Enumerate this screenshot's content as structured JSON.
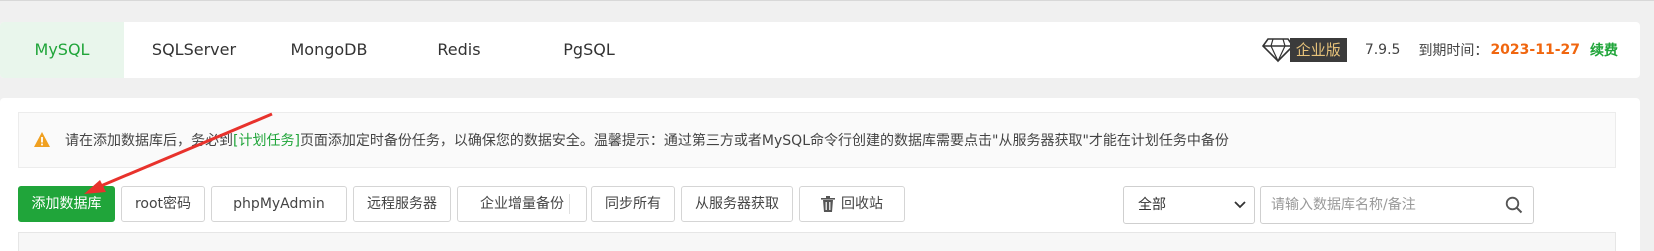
{
  "tabs": [
    {
      "label": "MySQL"
    },
    {
      "label": "SQLServer"
    },
    {
      "label": "MongoDB"
    },
    {
      "label": "Redis"
    },
    {
      "label": "PgSQL"
    }
  ],
  "vip": {
    "edition": "企业版",
    "version": "7.9.5",
    "expire_label": "到期时间：",
    "expire_date": "2023-11-27",
    "renew": "续费"
  },
  "notice": {
    "text_before": "请在添加数据库后，务必到",
    "link": "[计划任务]",
    "text_after": "页面添加定时备份任务，以确保您的数据安全。温馨提示：通过第三方或者MySQL命令行创建的数据库需要点击\"从服务器获取\"才能在计划任务中备份"
  },
  "toolbar": {
    "add": "添加数据库",
    "root": "root密码",
    "phpmyadmin": "phpMyAdmin",
    "remote": "远程服务器",
    "incremental": "企业增量备份",
    "sync_all": "同步所有",
    "fetch": "从服务器获取",
    "recycle": "回收站"
  },
  "filter": {
    "selected": "全部"
  },
  "search": {
    "placeholder": "请输入数据库名称/备注"
  },
  "colors": {
    "accent": "#20a53a",
    "expire": "#f0660f",
    "arrow": "#e8322c"
  }
}
